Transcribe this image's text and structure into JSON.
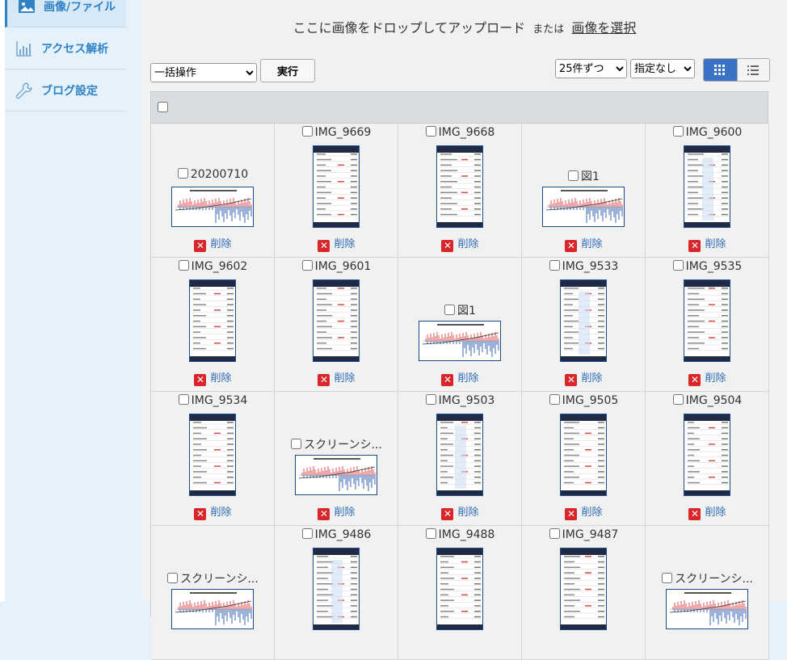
{
  "sidebar": {
    "items": [
      {
        "label": "画像/ファイル",
        "icon": "image-icon",
        "active": true
      },
      {
        "label": "アクセス解析",
        "icon": "bar-chart-icon",
        "active": false
      },
      {
        "label": "ブログ設定",
        "icon": "wrench-icon",
        "active": false
      }
    ]
  },
  "drop_zone": {
    "text": "ここに画像をドロップしてアップロード",
    "or": "または",
    "select_link": "画像を選択"
  },
  "toolbar": {
    "bulk_action": "一括操作",
    "run_label": "実行",
    "per_page": "25件ずつ",
    "sort": "指定なし"
  },
  "delete_label": "削除",
  "files": [
    {
      "name": "20200710",
      "thumb": "landscape"
    },
    {
      "name": "IMG_9669",
      "thumb": "portrait"
    },
    {
      "name": "IMG_9668",
      "thumb": "portrait"
    },
    {
      "name": "図1",
      "thumb": "landscape"
    },
    {
      "name": "IMG_9600",
      "thumb": "portrait"
    },
    {
      "name": "IMG_9602",
      "thumb": "portrait"
    },
    {
      "name": "IMG_9601",
      "thumb": "portrait"
    },
    {
      "name": "図1",
      "thumb": "landscape"
    },
    {
      "name": "IMG_9533",
      "thumb": "portrait"
    },
    {
      "name": "IMG_9535",
      "thumb": "portrait"
    },
    {
      "name": "IMG_9534",
      "thumb": "portrait"
    },
    {
      "name": "スクリーンシ...",
      "thumb": "landscape"
    },
    {
      "name": "IMG_9503",
      "thumb": "portrait"
    },
    {
      "name": "IMG_9505",
      "thumb": "portrait"
    },
    {
      "name": "IMG_9504",
      "thumb": "portrait"
    },
    {
      "name": "スクリーンシ...",
      "thumb": "landscape"
    },
    {
      "name": "IMG_9486",
      "thumb": "portrait"
    },
    {
      "name": "IMG_9488",
      "thumb": "portrait"
    },
    {
      "name": "IMG_9487",
      "thumb": "portrait"
    },
    {
      "name": "スクリーンシ...",
      "thumb": "landscape"
    }
  ],
  "colors": {
    "accent": "#2e82c5",
    "toggle_active": "#3a73c5",
    "delete_red": "#d8262a",
    "sidebar_bg": "#e6f2fb"
  }
}
